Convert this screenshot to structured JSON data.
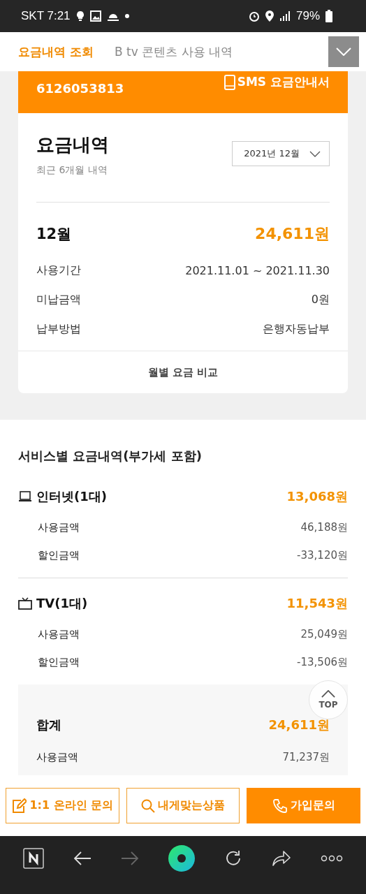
{
  "status_bar": {
    "carrier_time": "SKT 7:21",
    "battery": "79%"
  },
  "tabs": [
    {
      "label": "요금내역 조회",
      "selected": true
    },
    {
      "label": "B tv 콘텐츠 사용 내역",
      "selected": false
    }
  ],
  "account": {
    "number": "6126053813",
    "sms_button": "SMS 요금안내서"
  },
  "bill": {
    "title": "요금내역",
    "subtitle": "최근 6개월 내역",
    "month_select": "2021년 12월",
    "month": "12월",
    "total": "24,611원",
    "rows": [
      {
        "label": "사용기간",
        "value": "2021.11.01 ~ 2021.11.30"
      },
      {
        "label": "미납금액",
        "value": "0원"
      },
      {
        "label": "납부방법",
        "value": "은행자동납부"
      }
    ],
    "compare_link": "월별 요금 비교"
  },
  "services": {
    "title": "서비스별 요금내역(부가세 포함)",
    "groups": [
      {
        "kind": "laptop",
        "name": "인터넷(1대)",
        "amount": "13,068원",
        "rows": [
          {
            "label": "사용금액",
            "value": "46,188원"
          },
          {
            "label": "할인금액",
            "value": "-33,120원"
          }
        ]
      },
      {
        "kind": "tv",
        "name": "TV(1대)",
        "amount": "11,543원",
        "rows": [
          {
            "label": "사용금액",
            "value": "25,049원"
          },
          {
            "label": "할인금액",
            "value": "-13,506원"
          }
        ]
      }
    ],
    "summary": {
      "label": "합계",
      "amount": "24,611원",
      "rows": [
        {
          "label": "사용금액",
          "value": "71,237원"
        }
      ]
    }
  },
  "top_button": "TOP",
  "actions": [
    {
      "kind": "edit",
      "label": "1:1 온라인 문의",
      "primary": false
    },
    {
      "kind": "search",
      "label": "내게맞는상품",
      "primary": false
    },
    {
      "kind": "phone",
      "label": "가입문의",
      "primary": true
    }
  ]
}
